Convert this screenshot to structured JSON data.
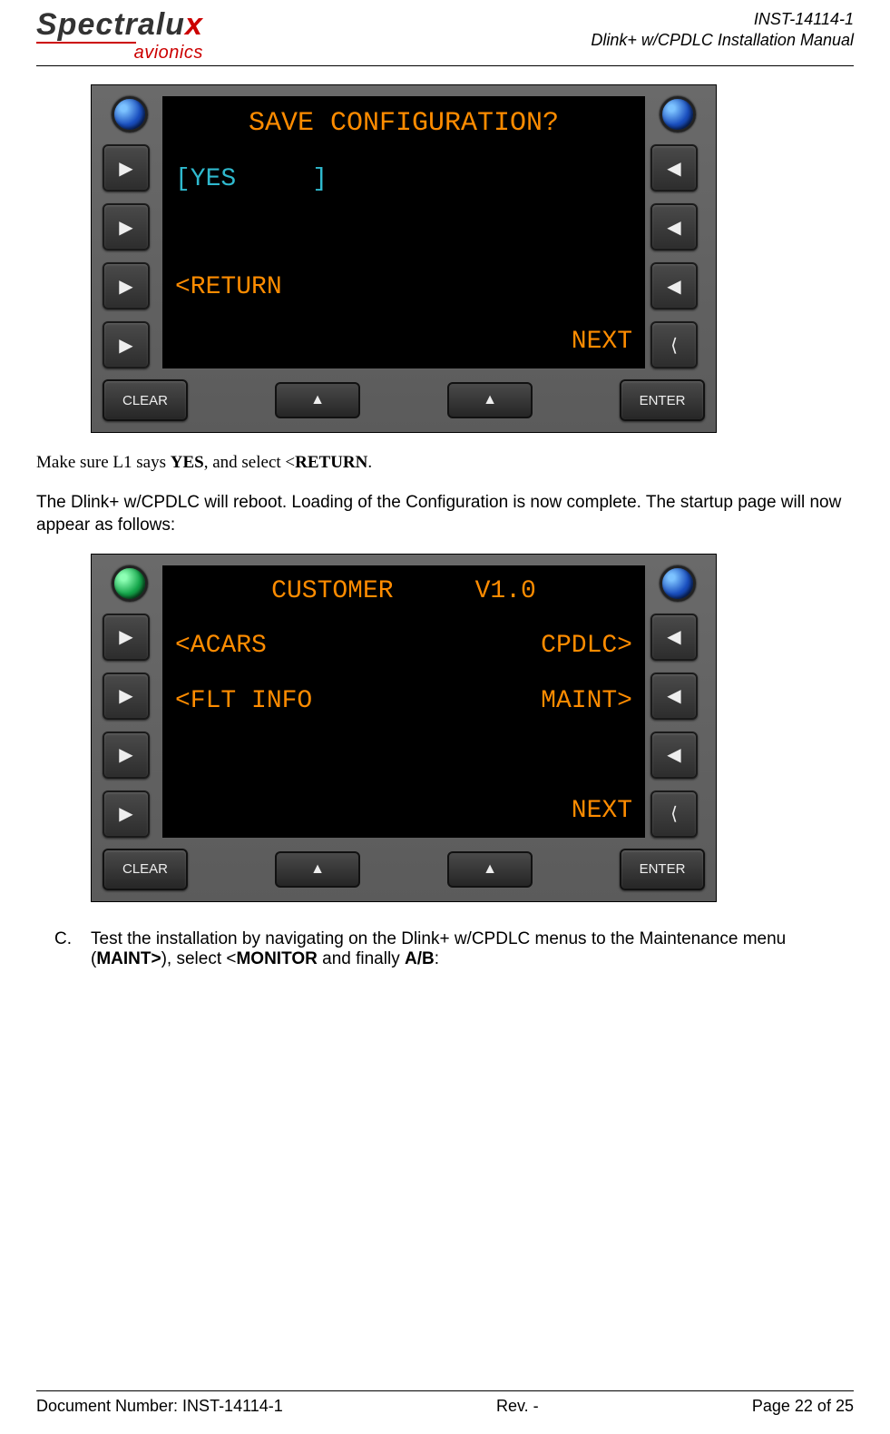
{
  "header": {
    "logo_top_1": "Spectralu",
    "logo_top_2": "x",
    "logo_bottom": "avionics",
    "doc_id": "INST-14114-1",
    "doc_title": "Dlink+ w/CPDLC Installation Manual"
  },
  "screen1": {
    "title": "SAVE CONFIGURATION?",
    "l1": "[YES     ]",
    "l3": "<RETURN",
    "r4": "NEXT"
  },
  "bottom_buttons": {
    "clear": "CLEAR",
    "enter": "ENTER"
  },
  "para1_pre": "Make sure L1 says ",
  "para1_b1": "YES",
  "para1_mid": ", and select <",
  "para1_b2": "RETURN",
  "para1_post": ".",
  "para2": "The Dlink+ w/CPDLC will reboot. Loading of the Configuration is now complete. The startup page will now appear as follows:",
  "screen2": {
    "title_l": "CUSTOMER",
    "title_r": "V1.0",
    "l1": "<ACARS",
    "r1": "CPDLC>",
    "l2": "<FLT INFO",
    "r2": "MAINT>",
    "r4": "NEXT"
  },
  "stepC": {
    "letter": "C.",
    "t1": "Test the installation by navigating on the Dlink+ w/CPDLC menus to the Maintenance menu (",
    "b1": "MAINT>",
    "t2": "), select <",
    "b2": "MONITOR",
    "t3": " and finally ",
    "b3": "A/B",
    "t4": ":"
  },
  "footer": {
    "left": "Document Number:  INST-14114-1",
    "mid": "Rev. -",
    "right": "Page 22 of 25"
  }
}
